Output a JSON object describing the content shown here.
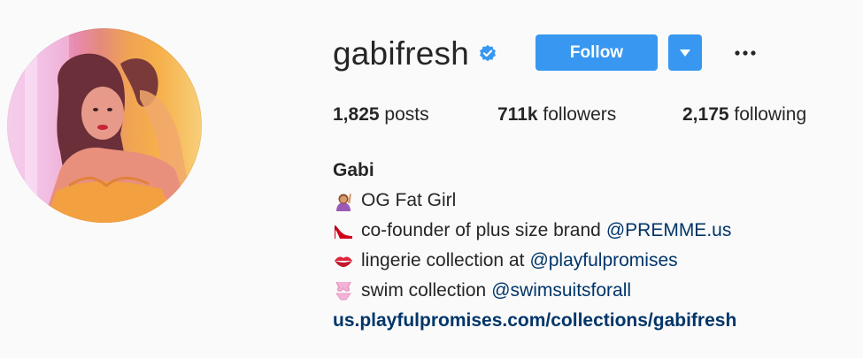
{
  "profile": {
    "username": "gabifresh",
    "verified_icon": "verified-badge-icon",
    "follow_label": "Follow",
    "dropdown_icon": "caret-down-icon",
    "more_icon": "more-options-icon"
  },
  "stats": {
    "posts_count": "1,825",
    "posts_label": "posts",
    "followers_count": "711k",
    "followers_label": "followers",
    "following_count": "2,175",
    "following_label": "following"
  },
  "bio": {
    "name": "Gabi",
    "lines": [
      {
        "icon": "woman-raising-hand-emoji",
        "text": "OG Fat Girl",
        "mention": ""
      },
      {
        "icon": "high-heel-emoji",
        "text": "co-founder of plus size brand",
        "mention": "@PREMME.us"
      },
      {
        "icon": "kiss-mark-emoji",
        "text": "lingerie collection at",
        "mention": "@playfulpromises"
      },
      {
        "icon": "bikini-emoji",
        "text": "swim collection",
        "mention": "@swimsuitsforall"
      }
    ],
    "website": "us.playfulpromises.com/collections/gabifresh"
  },
  "colors": {
    "accent": "#3897f0",
    "link": "#003569",
    "text": "#262626",
    "background": "#fafafa"
  }
}
